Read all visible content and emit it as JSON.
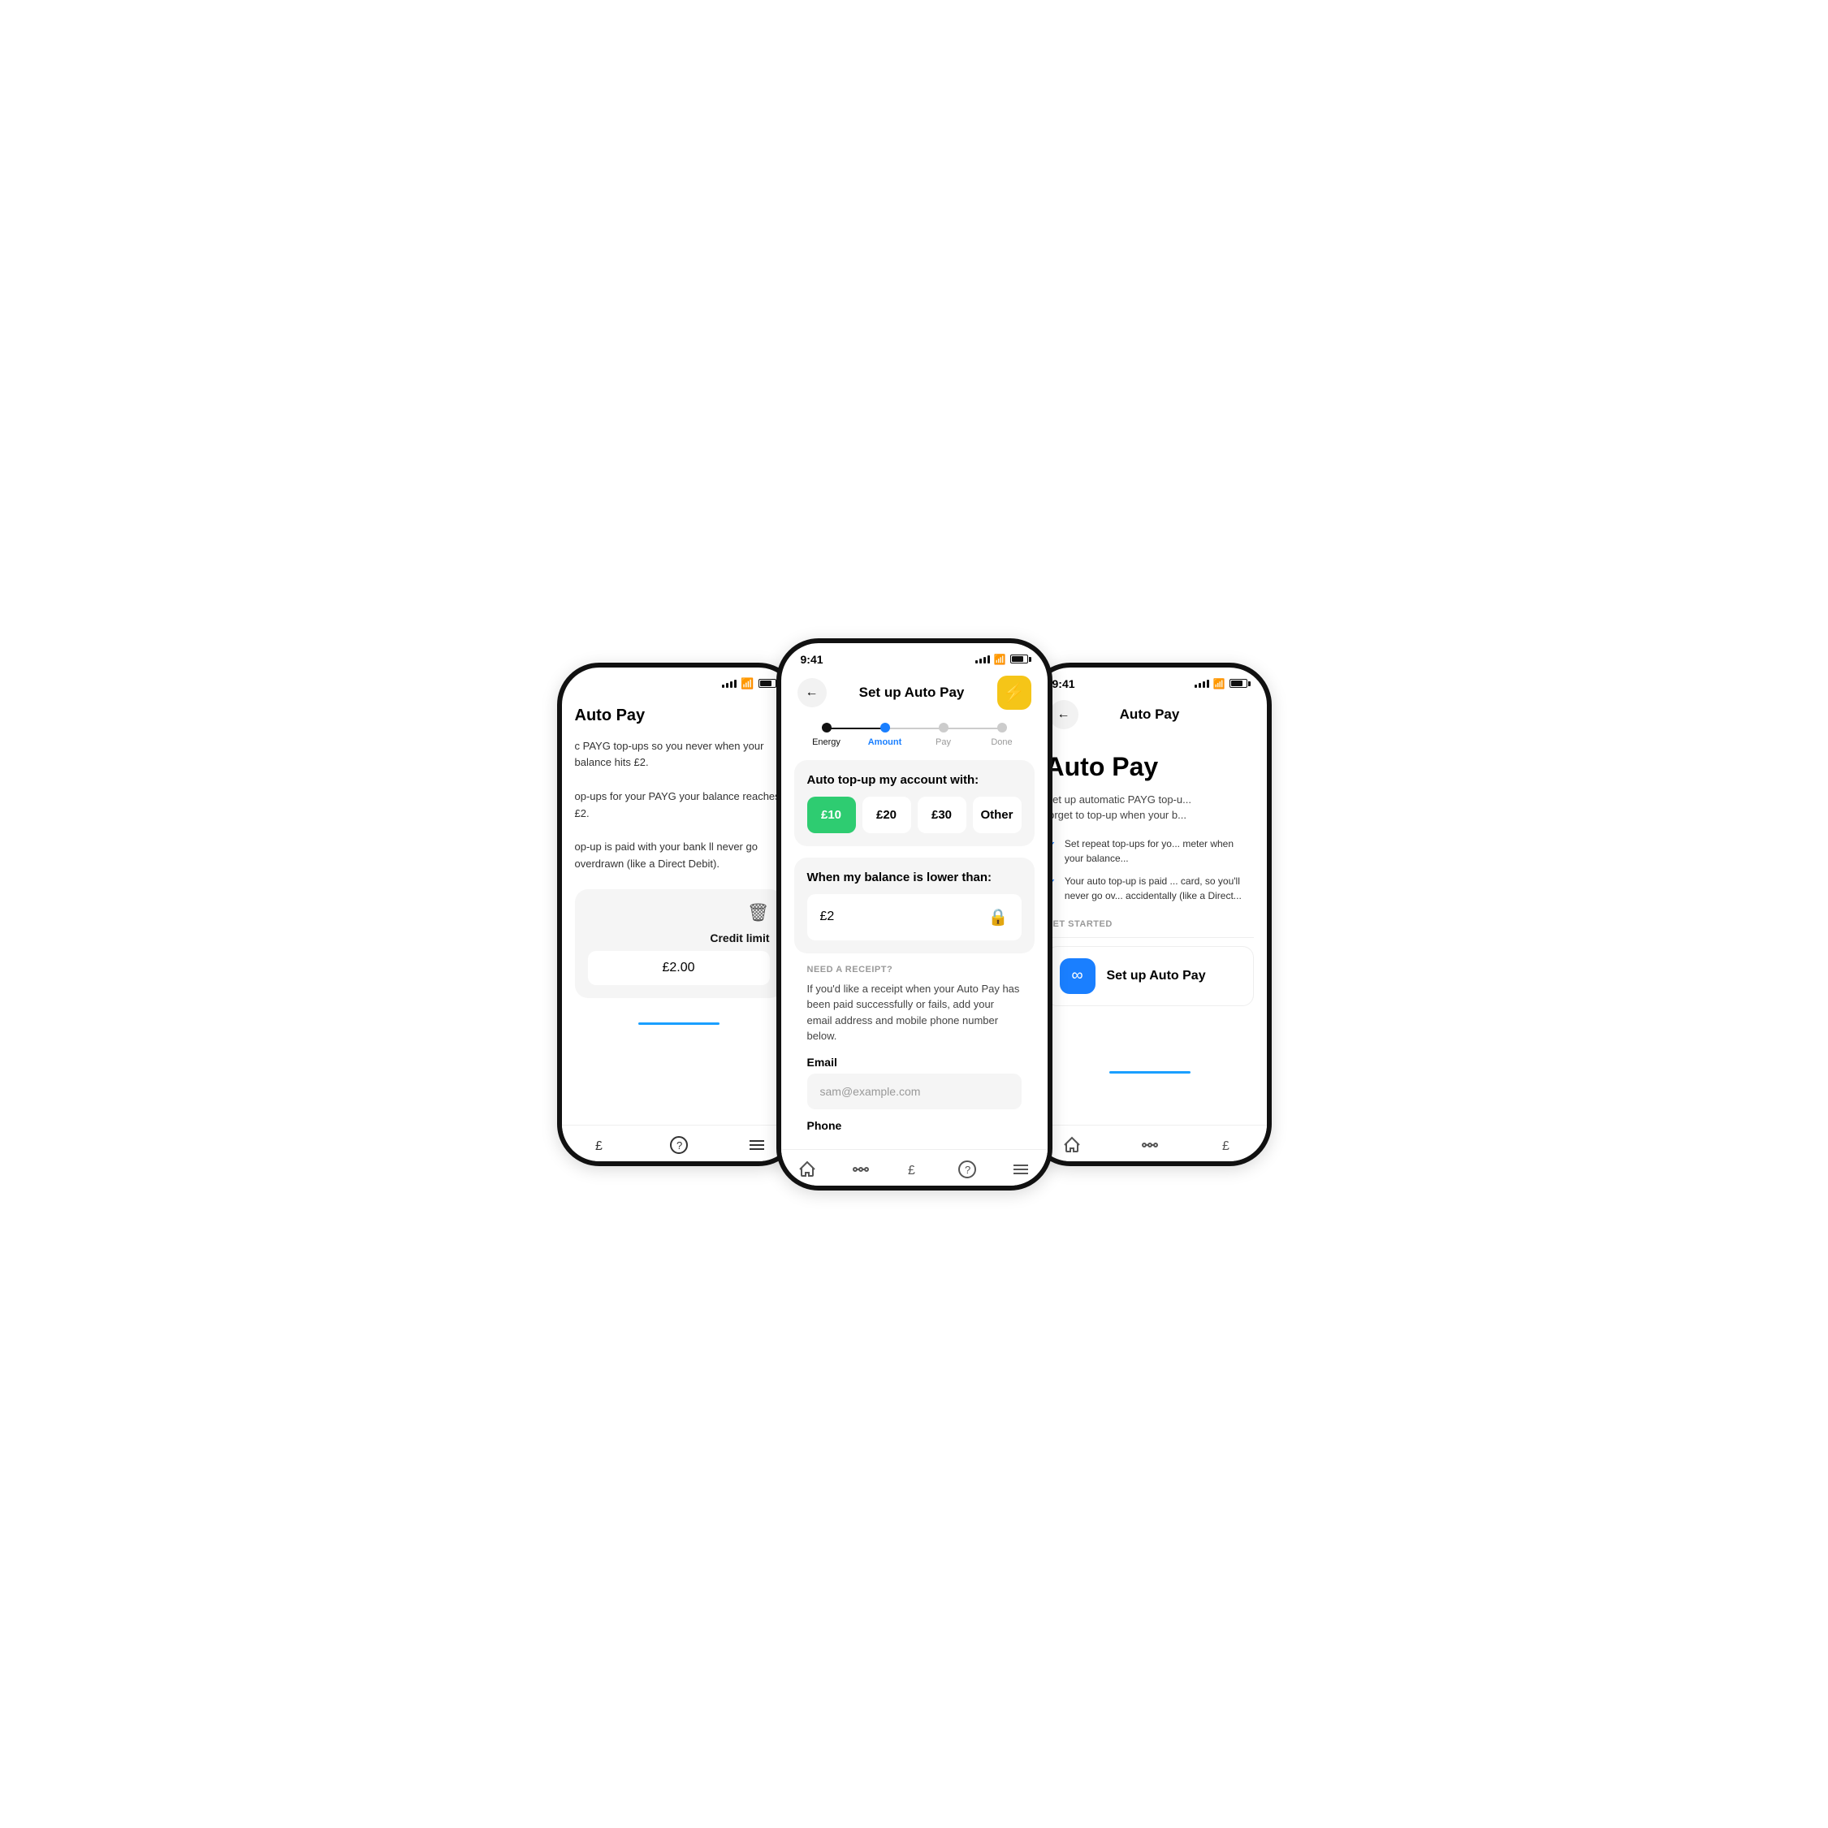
{
  "left_phone": {
    "title": "Auto Pay",
    "description_1": "c PAYG top-ups so you never when your balance hits £2.",
    "description_2": "op-ups for your PAYG your balance reaches £2.",
    "description_3": "op-up is paid with your bank ll never go overdrawn (like a Direct Debit).",
    "credit_label": "Credit limit",
    "credit_value": "£2.00",
    "nav_items": [
      "£",
      "?",
      "≡"
    ]
  },
  "center_phone": {
    "status_time": "9:41",
    "header_title": "Set up Auto Pay",
    "steps": [
      {
        "label": "Energy",
        "state": "done"
      },
      {
        "label": "Amount",
        "state": "active"
      },
      {
        "label": "Pay",
        "state": "upcoming"
      },
      {
        "label": "Done",
        "state": "upcoming"
      }
    ],
    "top_up_card": {
      "title": "Auto top-up my account with:",
      "options": [
        {
          "label": "£10",
          "selected": true
        },
        {
          "label": "£20",
          "selected": false
        },
        {
          "label": "£30",
          "selected": false
        },
        {
          "label": "Other",
          "selected": false
        }
      ]
    },
    "balance_card": {
      "title": "When my balance is lower than:",
      "value": "£2"
    },
    "receipt_section": {
      "label": "NEED A RECEIPT?",
      "description": "If you'd like a receipt when your Auto Pay has been paid successfully or fails, add your email address and mobile phone number below.",
      "email_label": "Email",
      "email_placeholder": "sam@example.com",
      "phone_label": "Phone"
    },
    "nav_items": [
      "house",
      "dots",
      "pound",
      "question",
      "menu"
    ]
  },
  "right_phone": {
    "status_time": "9:41",
    "header_title": "Auto Pay",
    "page_title": "Auto Pay",
    "description": "Set up automatic PAYG top-u... forget to top-up when your b...",
    "features": [
      "Set repeat top-ups for yo... meter when your balance...",
      "Your auto top-up is paid ... card, so you'll never go ov... accidentally (like a Direct..."
    ],
    "get_started_label": "GET STARTED",
    "setup_button_label": "Set up Auto Pay",
    "nav_items": [
      "house",
      "dots",
      "pound"
    ]
  },
  "icons": {
    "back_arrow": "←",
    "lightning": "⚡",
    "trash": "🗑",
    "lock": "🔒",
    "checkmark": "✓",
    "infinity": "∞"
  }
}
